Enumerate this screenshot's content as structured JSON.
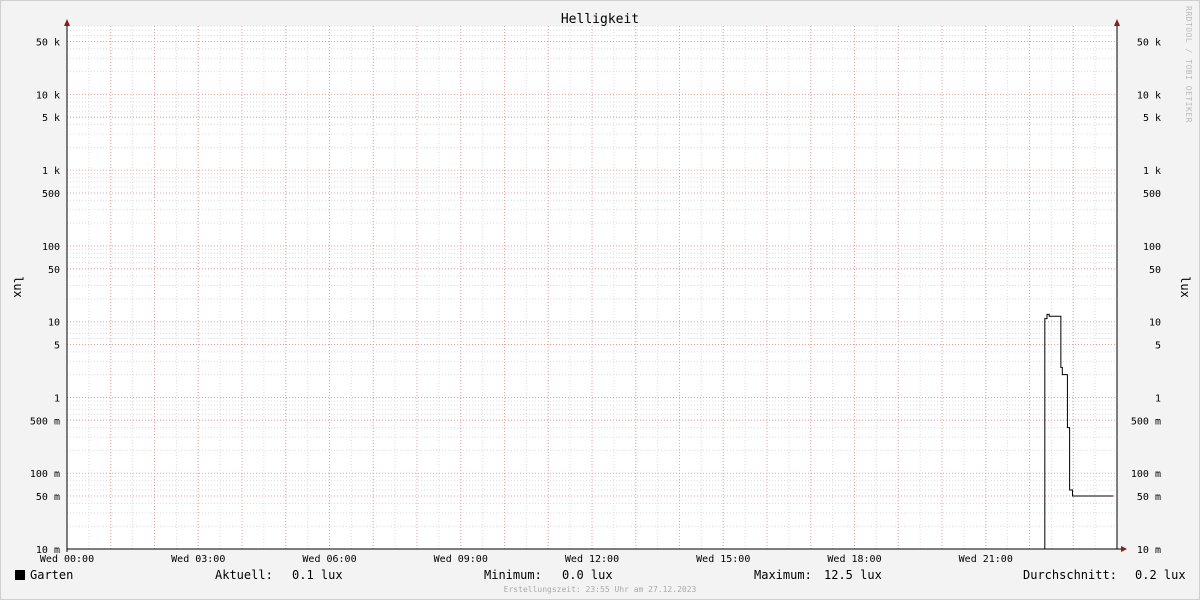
{
  "chart_data": {
    "type": "line",
    "title": "Helligkeit",
    "ylabel_left": "lux",
    "ylabel_right": "lux",
    "y_scale": "log",
    "ylim": [
      0.01,
      80000
    ],
    "y_ticks": [
      {
        "value": 50000,
        "label": "50 k"
      },
      {
        "value": 10000,
        "label": "10 k"
      },
      {
        "value": 5000,
        "label": "5 k"
      },
      {
        "value": 1000,
        "label": "1 k"
      },
      {
        "value": 500,
        "label": "500"
      },
      {
        "value": 100,
        "label": "100"
      },
      {
        "value": 50,
        "label": "50"
      },
      {
        "value": 10,
        "label": "10"
      },
      {
        "value": 5,
        "label": "5"
      },
      {
        "value": 1,
        "label": "1"
      },
      {
        "value": 0.5,
        "label": "500 m"
      },
      {
        "value": 0.1,
        "label": "100 m"
      },
      {
        "value": 0.05,
        "label": "50 m"
      },
      {
        "value": 0.01,
        "label": "10 m"
      }
    ],
    "xlim": [
      "00:00",
      "24:00"
    ],
    "x_ticks": [
      "Wed 00:00",
      "Wed 03:00",
      "Wed 06:00",
      "Wed 09:00",
      "Wed 12:00",
      "Wed 15:00",
      "Wed 18:00",
      "Wed 21:00"
    ],
    "grid": true,
    "series": [
      {
        "name": "Garten",
        "color": "#000000",
        "points": [
          {
            "t": "00:00",
            "v": 0.01
          },
          {
            "t": "22:20",
            "v": 0.01
          },
          {
            "t": "22:21",
            "v": 11.0
          },
          {
            "t": "22:24",
            "v": 12.5
          },
          {
            "t": "22:27",
            "v": 11.8
          },
          {
            "t": "22:43",
            "v": 2.5
          },
          {
            "t": "22:45",
            "v": 2.0
          },
          {
            "t": "22:52",
            "v": 0.4
          },
          {
            "t": "22:55",
            "v": 0.06
          },
          {
            "t": "22:59",
            "v": 0.05
          },
          {
            "t": "23:55",
            "v": 0.05
          }
        ]
      }
    ]
  },
  "legend": {
    "series_name": "Garten",
    "current_label": "Aktuell:",
    "current_value": "0.1 lux",
    "min_label": "Minimum:",
    "min_value": "0.0 lux",
    "max_label": "Maximum:",
    "max_value": "12.5 lux",
    "avg_label": "Durchschnitt:",
    "avg_value": "0.2 lux"
  },
  "footer": {
    "created": "Erstellungszeit: 23:55 Uhr am 27.12.2023"
  },
  "watermark": "RRDTOOL / TOBI OETIKER"
}
